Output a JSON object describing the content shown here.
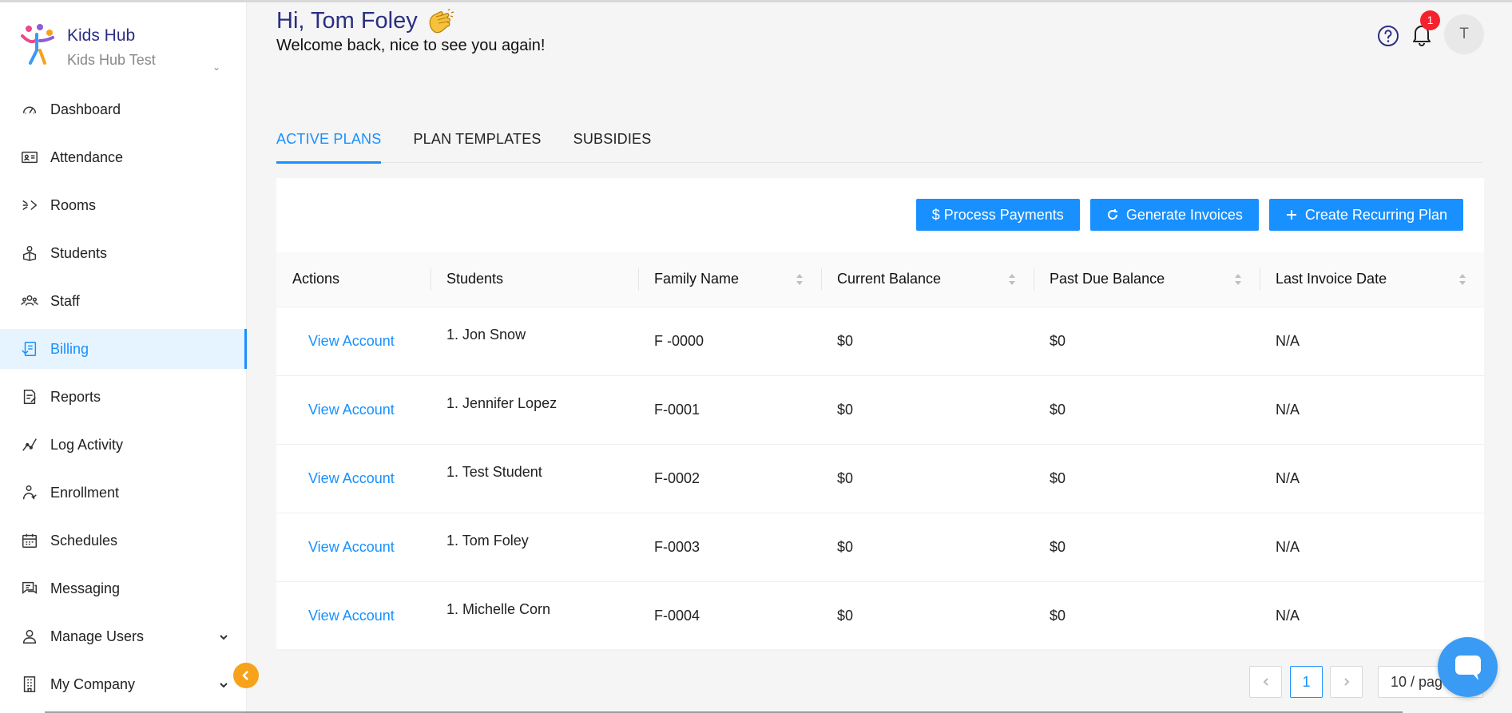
{
  "brand": {
    "name": "Kids Hub",
    "subtitle": "Kids Hub Test",
    "caret": "⌄"
  },
  "sidebar": {
    "items": [
      {
        "label": "Dashboard"
      },
      {
        "label": "Attendance"
      },
      {
        "label": "Rooms"
      },
      {
        "label": "Students"
      },
      {
        "label": "Staff"
      },
      {
        "label": "Billing",
        "active": true
      },
      {
        "label": "Reports"
      },
      {
        "label": "Log Activity"
      },
      {
        "label": "Enrollment"
      },
      {
        "label": "Schedules"
      },
      {
        "label": "Messaging"
      },
      {
        "label": "Manage Users",
        "expandable": true
      },
      {
        "label": "My Company",
        "expandable": true
      }
    ]
  },
  "header": {
    "greeting": "Hi, Tom Foley",
    "welcome": "Welcome back, nice to see you again!",
    "notification_count": "1",
    "avatar_initial": "T"
  },
  "tabs": [
    {
      "label": "ACTIVE PLANS",
      "active": true
    },
    {
      "label": "PLAN TEMPLATES"
    },
    {
      "label": "SUBSIDIES"
    }
  ],
  "actions": {
    "process_payments": "$ Process Payments",
    "generate_invoices": "Generate Invoices",
    "create_plan": "Create Recurring Plan"
  },
  "table": {
    "columns": [
      "Actions",
      "Students",
      "Family Name",
      "Current Balance",
      "Past Due Balance",
      "Last Invoice Date"
    ],
    "rows": [
      {
        "action": "View Account",
        "student": "1. Jon Snow",
        "family": "F -0000",
        "current": "$0",
        "past_due": "$0",
        "last_invoice": "N/A"
      },
      {
        "action": "View Account",
        "student": "1. Jennifer Lopez",
        "family": "F-0001",
        "current": "$0",
        "past_due": "$0",
        "last_invoice": "N/A"
      },
      {
        "action": "View Account",
        "student": "1. Test Student",
        "family": "F-0002",
        "current": "$0",
        "past_due": "$0",
        "last_invoice": "N/A"
      },
      {
        "action": "View Account",
        "student": "1. Tom Foley",
        "family": "F-0003",
        "current": "$0",
        "past_due": "$0",
        "last_invoice": "N/A"
      },
      {
        "action": "View Account",
        "student": "1. Michelle Corn",
        "family": "F-0004",
        "current": "$0",
        "past_due": "$0",
        "last_invoice": "N/A"
      }
    ]
  },
  "pagination": {
    "current_page": "1",
    "page_size": "10 / page"
  },
  "colors": {
    "accent": "#1890ff",
    "brand": "#2b2e83",
    "badge": "#f5222d",
    "collapse": "#f7a21b"
  }
}
